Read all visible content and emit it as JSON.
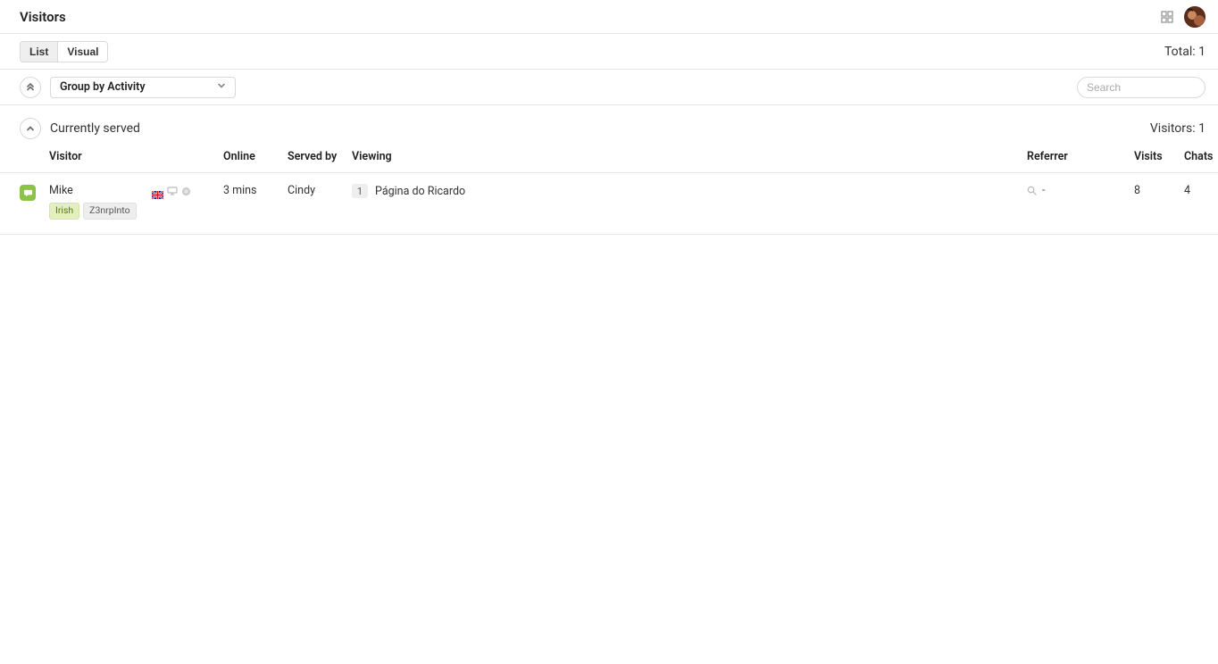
{
  "header": {
    "title": "Visitors"
  },
  "tabs": {
    "list": "List",
    "visual": "Visual",
    "active": "list"
  },
  "total": {
    "label": "Total:",
    "value": "1"
  },
  "filters": {
    "group_by_label": "Group by Activity",
    "search_placeholder": "Search"
  },
  "group": {
    "title": "Currently served",
    "visitors_label": "Visitors:",
    "visitors_count": "1"
  },
  "columns": {
    "visitor": "Visitor",
    "online": "Online",
    "served_by": "Served by",
    "viewing": "Viewing",
    "referrer": "Referrer",
    "visits": "Visits",
    "chats": "Chats"
  },
  "rows": [
    {
      "name": "Mike",
      "tags": [
        {
          "text": "Irish",
          "kind": "green"
        },
        {
          "text": "Z3nrpInto",
          "kind": "gray"
        }
      ],
      "online": "3 mins",
      "served_by": "Cindy",
      "viewing_count": "1",
      "viewing_page": "Página do Ricardo",
      "referrer": "-",
      "visits": "8",
      "chats": "4"
    }
  ]
}
